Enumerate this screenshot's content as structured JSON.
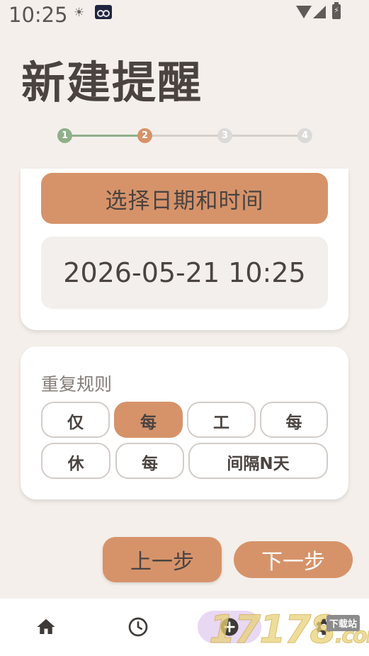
{
  "status_bar": {
    "time": "10:25",
    "icons": [
      "sun-icon",
      "app-notification-icon",
      "wifi-icon",
      "signal-icon",
      "battery-charging-icon"
    ]
  },
  "page": {
    "title": "新建提醒"
  },
  "stepper": {
    "steps": [
      "1",
      "2",
      "3",
      "4"
    ],
    "current_step": 2
  },
  "date_card": {
    "pick_label": "选择日期和时间",
    "datetime_value": "2026-05-21 10:25"
  },
  "repeat_card": {
    "title": "重复规则",
    "options": [
      {
        "label": "仅",
        "selected": false
      },
      {
        "label": "每",
        "selected": true
      },
      {
        "label": "工",
        "selected": false
      },
      {
        "label": "每",
        "selected": false
      },
      {
        "label": "休",
        "selected": false
      },
      {
        "label": "每",
        "selected": false
      },
      {
        "label": "间隔N天",
        "selected": false
      }
    ]
  },
  "actions": {
    "prev_label": "上一步",
    "next_label": "下一步"
  },
  "bottom_nav": {
    "items": [
      "home-icon",
      "clock-icon",
      "add-circle-icon",
      "settings-icon"
    ],
    "active": "add-circle-icon"
  },
  "watermark": {
    "text": "17178",
    "suffix": ".com",
    "badge": "下载站"
  },
  "colors": {
    "background": "#f4efeb",
    "accent": "#d6936a",
    "step_done": "#8fb08a",
    "text": "#4a4340"
  }
}
